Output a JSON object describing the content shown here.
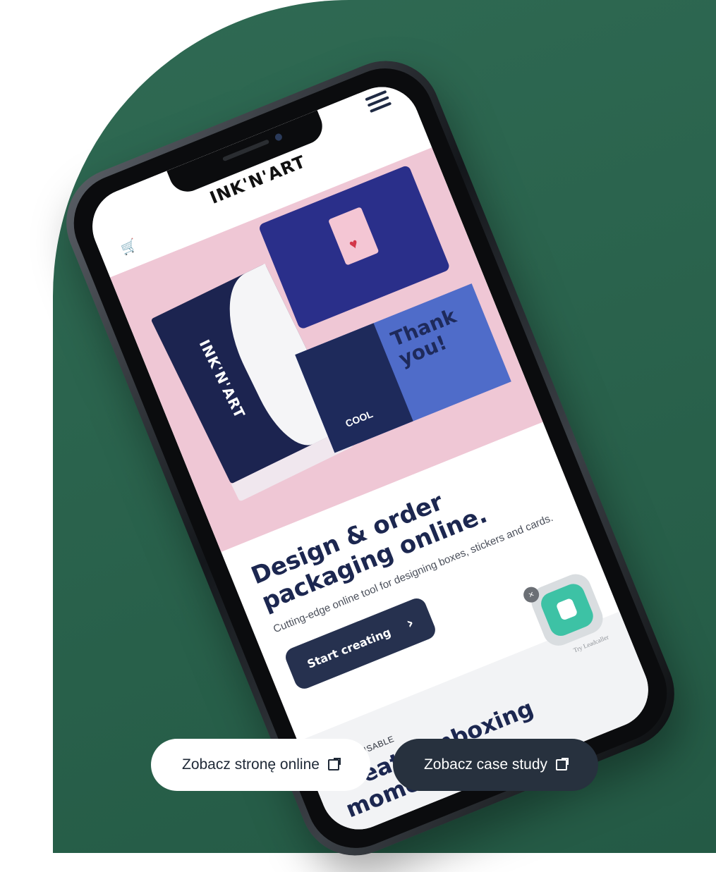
{
  "colors": {
    "background": "#ffffff",
    "bg_shape_from": "#2f6a53",
    "bg_shape_to": "#245a45",
    "brand_navy": "#1c2750",
    "hero_pink": "#efc7d5",
    "cta_bg": "#26314f",
    "call_green": "#3dc2a5"
  },
  "phone": {
    "site": {
      "logo": "INK'N'ART",
      "cart_icon": "cart-icon",
      "menu_icon": "hamburger-menu-icon",
      "hero": {
        "box_brand": "INK'N'ART",
        "card_text": "Thank you!",
        "card_small": "COOL"
      },
      "title": "Design & order packaging online.",
      "subtitle": "Cutting-edge online tool for designing boxes, stickers and cards.",
      "cta_label": "Start creating",
      "cta_icon": "chevron-right-icon",
      "section2": {
        "eyebrow": "CUSTOMISABLE",
        "heading": "Create unboxing moments."
      },
      "call_widget": {
        "icon": "phone-icon",
        "close_icon": "close-icon",
        "powered_by": "Try Leadcaller"
      }
    }
  },
  "actions": {
    "view_online": "Zobacz stronę online",
    "view_case_study": "Zobacz case study",
    "external_icon": "external-link-icon"
  }
}
